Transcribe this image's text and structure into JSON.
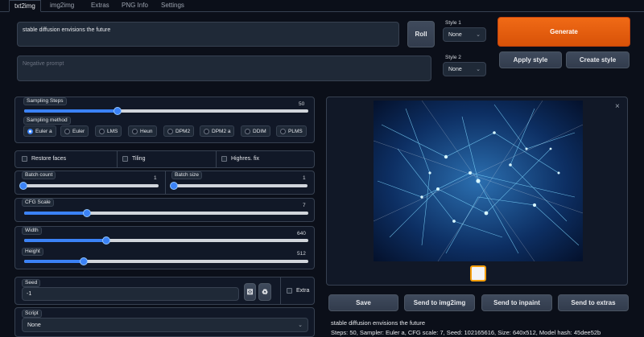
{
  "tabs": [
    "txt2img",
    "img2img",
    "Extras",
    "PNG Info",
    "Settings"
  ],
  "prompt": {
    "value": "stable diffusion envisions the future",
    "negative_placeholder": "Negative prompt"
  },
  "buttons": {
    "roll": "Roll",
    "generate": "Generate",
    "apply_style": "Apply style",
    "create_style": "Create style",
    "save": "Save",
    "send_img2img": "Send to img2img",
    "send_inpaint": "Send to inpaint",
    "send_extras": "Send to extras"
  },
  "style1": {
    "label": "Style 1",
    "value": "None"
  },
  "style2": {
    "label": "Style 2",
    "value": "None"
  },
  "sampling_steps": {
    "label": "Sampling Steps",
    "value": "50",
    "fraction": 0.33
  },
  "sampling_method": {
    "label": "Sampling method",
    "options": [
      "Euler a",
      "Euler",
      "LMS",
      "Heun",
      "DPM2",
      "DPM2 a",
      "DDIM",
      "PLMS"
    ],
    "selected": "Euler a"
  },
  "checks": {
    "restore_faces": "Restore faces",
    "tiling": "Tiling",
    "highres": "Highres. fix"
  },
  "batch_count": {
    "label": "Batch count",
    "value": "1",
    "fraction": 0.0
  },
  "batch_size": {
    "label": "Batch size",
    "value": "1",
    "fraction": 0.0
  },
  "cfg_scale": {
    "label": "CFG Scale",
    "value": "7",
    "fraction": 0.22
  },
  "width": {
    "label": "Width",
    "value": "640",
    "fraction": 0.29
  },
  "height": {
    "label": "Height",
    "value": "512",
    "fraction": 0.21
  },
  "seed": {
    "label": "Seed",
    "value": "-1",
    "extra_label": "Extra"
  },
  "script": {
    "label": "Script",
    "value": "None"
  },
  "output": {
    "prompt_text": "stable diffusion envisions the future",
    "info_text": "Steps: 50, Sampler: Euler a, CFG scale: 7, Seed: 102165616, Size: 640x512, Model hash: 45dee52b"
  },
  "icons": {
    "close": "close-icon",
    "dice": "dice-icon",
    "recycle": "recycle-icon"
  },
  "colors": {
    "accent": "#3b82f6",
    "generate": "#ea580c",
    "background": "#0b0f19"
  }
}
